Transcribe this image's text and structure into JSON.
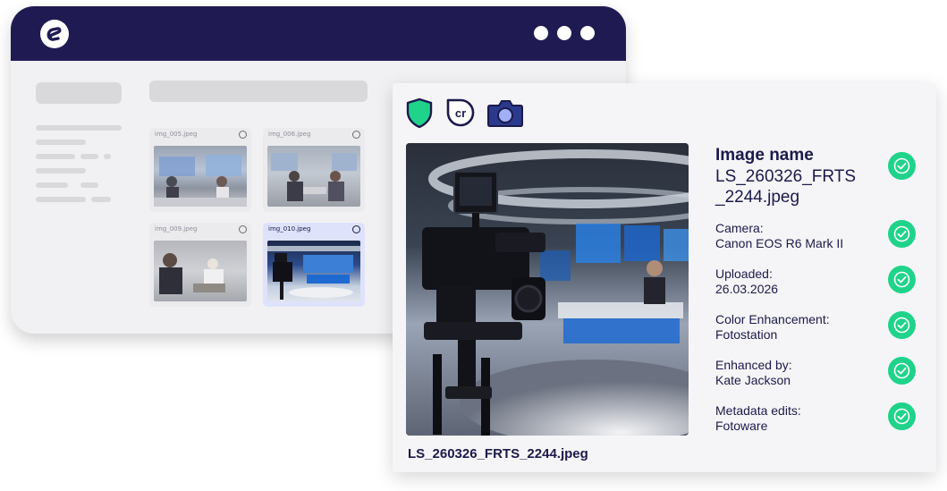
{
  "colors": {
    "titlebar": "#1f1b52",
    "accent_green": "#1fd38a",
    "camera_blue": "#2b3a8c",
    "selected_thumb": "#dfe2fb"
  },
  "back_window": {
    "logo": "app-logo-icon",
    "thumbnails": [
      {
        "label": "img_005.jpeg",
        "selected": false
      },
      {
        "label": "img_006.jpeg",
        "selected": false
      },
      {
        "label": "img_009.jpeg",
        "selected": false
      },
      {
        "label": "img_010.jpeg",
        "selected": true
      }
    ]
  },
  "detail_card": {
    "icons": [
      "shield-icon",
      "content-credentials-icon",
      "camera-icon"
    ],
    "caption": "LS_260326_FRTS_2244.jpeg",
    "image_name_label": "Image name",
    "image_name_value": "LS_260326_FRTS _2244.jpeg",
    "fields": [
      {
        "label": "Camera:",
        "value": "Canon EOS R6 Mark II"
      },
      {
        "label": "Uploaded:",
        "value": "26.03.2026"
      },
      {
        "label": "Color Enhancement:",
        "value": "Fotostation"
      },
      {
        "label": "Enhanced by:",
        "value": "Kate Jackson"
      },
      {
        "label": "Metadata edits:",
        "value": "Fotoware"
      }
    ]
  }
}
